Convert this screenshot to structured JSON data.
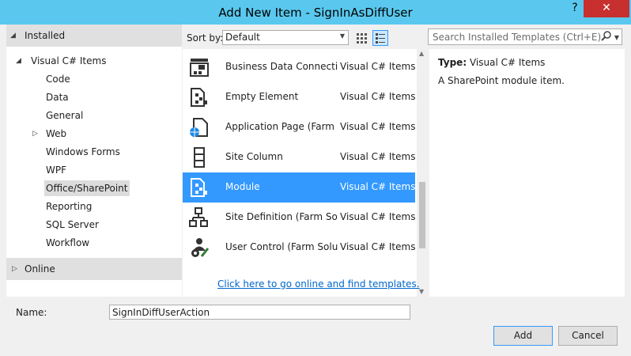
{
  "window": {
    "title": "Add New Item - SignInAsDiffUser",
    "help": "?",
    "close": "✕"
  },
  "tree": {
    "installed": "Installed",
    "root": "Visual C# Items",
    "children": [
      "Code",
      "Data",
      "General",
      "Web",
      "Windows Forms",
      "WPF",
      "Office/SharePoint",
      "Reporting",
      "SQL Server",
      "Workflow"
    ],
    "selected": "Office/SharePoint",
    "online": "Online"
  },
  "toolbar": {
    "sort_label": "Sort by:",
    "sort_value": "Default"
  },
  "search": {
    "placeholder": "Search Installed Templates (Ctrl+E)"
  },
  "templates": [
    {
      "name": "Business Data Connectivit...",
      "category": "Visual C# Items",
      "icon": "bdc-model-icon"
    },
    {
      "name": "Empty Element",
      "category": "Visual C# Items",
      "icon": "empty-element-icon"
    },
    {
      "name": "Application Page (Farm S...",
      "category": "Visual C# Items",
      "icon": "application-page-icon"
    },
    {
      "name": "Site Column",
      "category": "Visual C# Items",
      "icon": "site-column-icon"
    },
    {
      "name": "Module",
      "category": "Visual C# Items",
      "icon": "module-icon",
      "selected": true
    },
    {
      "name": "Site Definition (Farm Solu...",
      "category": "Visual C# Items",
      "icon": "site-definition-icon"
    },
    {
      "name": "User Control (Farm Soluti...",
      "category": "Visual C# Items",
      "icon": "user-control-icon"
    }
  ],
  "online_link": "Click here to go online and find templates.",
  "details": {
    "type_label": "Type:",
    "type_value": "Visual C# Items",
    "description": "A SharePoint module item."
  },
  "name_field": {
    "label": "Name:",
    "value": "SignInDiffUserAction"
  },
  "buttons": {
    "add": "Add",
    "cancel": "Cancel"
  },
  "colors": {
    "titlebar": "#5ac8ee",
    "selection": "#3399ff",
    "close": "#c7302f",
    "link": "#0066cc"
  }
}
